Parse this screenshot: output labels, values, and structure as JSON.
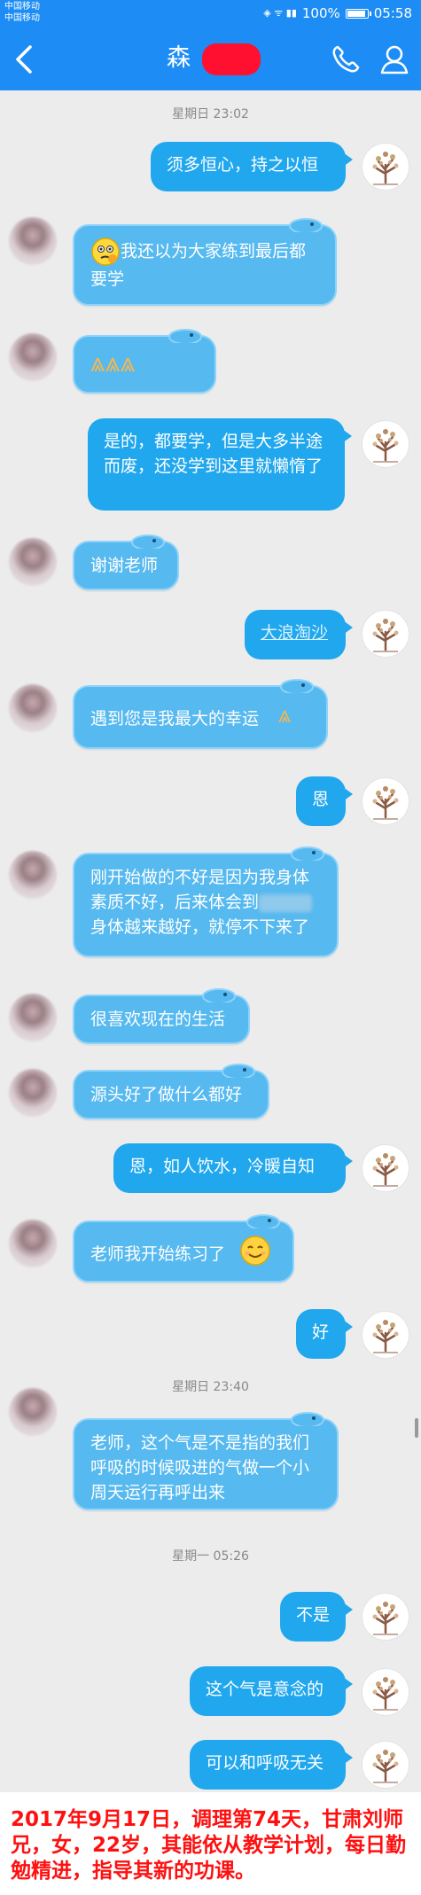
{
  "status_bar": {
    "carrier_1": "中国移动",
    "carrier_2": "中国移动",
    "battery": "100%",
    "battery_level": 1.0,
    "clock": "05:58"
  },
  "header": {
    "title": "森",
    "back_icon": "back-arrow-icon",
    "phone_icon": "phone-icon",
    "contact_icon": "contact-profile-icon"
  },
  "timestamps": [
    "星期日 23:02",
    "星期日 23:40",
    "星期一 05:26"
  ],
  "messages": [
    {
      "from": "teacher",
      "text": "须多恒心，持之以恒"
    },
    {
      "from": "student",
      "emoji": "thinking-face",
      "text": "我还以为大家练到最后都要学"
    },
    {
      "from": "student",
      "emoji": "folded-hands-x3",
      "text": ""
    },
    {
      "from": "teacher",
      "text": "是的，都要学，但是大多半途而废，还没学到这里就懒惰了"
    },
    {
      "from": "student",
      "text": "谢谢老师"
    },
    {
      "from": "teacher",
      "text": "大浪淘沙",
      "is_link": true
    },
    {
      "from": "student",
      "text": "遇到您是我最大的幸运",
      "emoji": "folded-hands"
    },
    {
      "from": "teacher",
      "text": "恩"
    },
    {
      "from": "student",
      "text_1": "刚开始做的不好是因为我身体素质不好，后来体会到",
      "text_2": "身体越来越好，就停不下来了"
    },
    {
      "from": "student",
      "text": "很喜欢现在的生活"
    },
    {
      "from": "student",
      "text": "源头好了做什么都好"
    },
    {
      "from": "teacher",
      "text": "恩，如人饮水，冷暖自知"
    },
    {
      "from": "student",
      "text": "老师我开始练习了",
      "emoji": "smiling-face"
    },
    {
      "from": "teacher",
      "text": "好"
    },
    {
      "from": "student",
      "text": "老师，这个气是不是指的我们呼吸的时候吸进的气做一个小周天运行再呼出来"
    },
    {
      "from": "teacher",
      "text": "不是"
    },
    {
      "from": "teacher",
      "text": "这个气是意念的"
    },
    {
      "from": "teacher",
      "text": "可以和呼吸无关"
    }
  ],
  "colors": {
    "header_blue": "#1d8df5",
    "bubble_out": "#20a7ee",
    "bubble_in": "#56b9ef",
    "caption_red": "#ff1010",
    "background": "#ececec"
  },
  "caption": "2017年9月17日，调理第74天，甘肃刘师兄，女，22岁，其能依从教学计划，每日勤勉精进，指导其新的功课。"
}
